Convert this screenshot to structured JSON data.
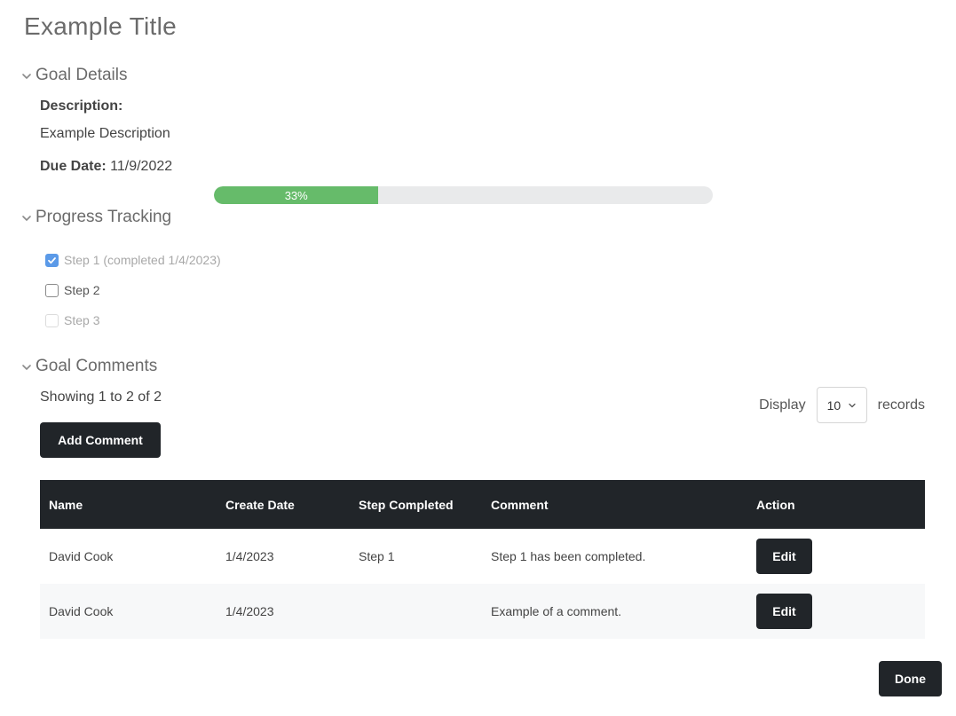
{
  "page": {
    "title": "Example Title"
  },
  "goal_details": {
    "section_title": "Goal Details",
    "description_label": "Description:",
    "description_value": "Example Description",
    "due_date_label": "Due Date:",
    "due_date_value": "11/9/2022"
  },
  "progress": {
    "percent": 33,
    "label": "33%",
    "fill_color": "#66bb6a"
  },
  "progress_tracking": {
    "section_title": "Progress Tracking",
    "steps": [
      {
        "label": "Step 1 (completed 1/4/2023)",
        "checked": true,
        "disabled": true
      },
      {
        "label": "Step 2",
        "checked": false,
        "disabled": false
      },
      {
        "label": "Step 3",
        "checked": false,
        "disabled": true
      }
    ]
  },
  "goal_comments": {
    "section_title": "Goal Comments",
    "showing_text": "Showing 1 to 2 of 2",
    "display_label": "Display",
    "records_label": "records",
    "page_size": "10",
    "add_comment_label": "Add Comment",
    "table": {
      "headers": [
        "Name",
        "Create Date",
        "Step Completed",
        "Comment",
        "Action"
      ],
      "rows": [
        {
          "name": "David Cook",
          "create_date": "1/4/2023",
          "step": "Step 1",
          "comment": "Step 1 has been completed.",
          "action": "Edit"
        },
        {
          "name": "David Cook",
          "create_date": "1/4/2023",
          "step": "",
          "comment": "Example of a comment.",
          "action": "Edit"
        }
      ]
    }
  },
  "footer": {
    "done_label": "Done"
  },
  "colors": {
    "dark": "#212529",
    "checkbox_checked": "#5b9ae8",
    "title_gray": "#6b6b6b"
  }
}
